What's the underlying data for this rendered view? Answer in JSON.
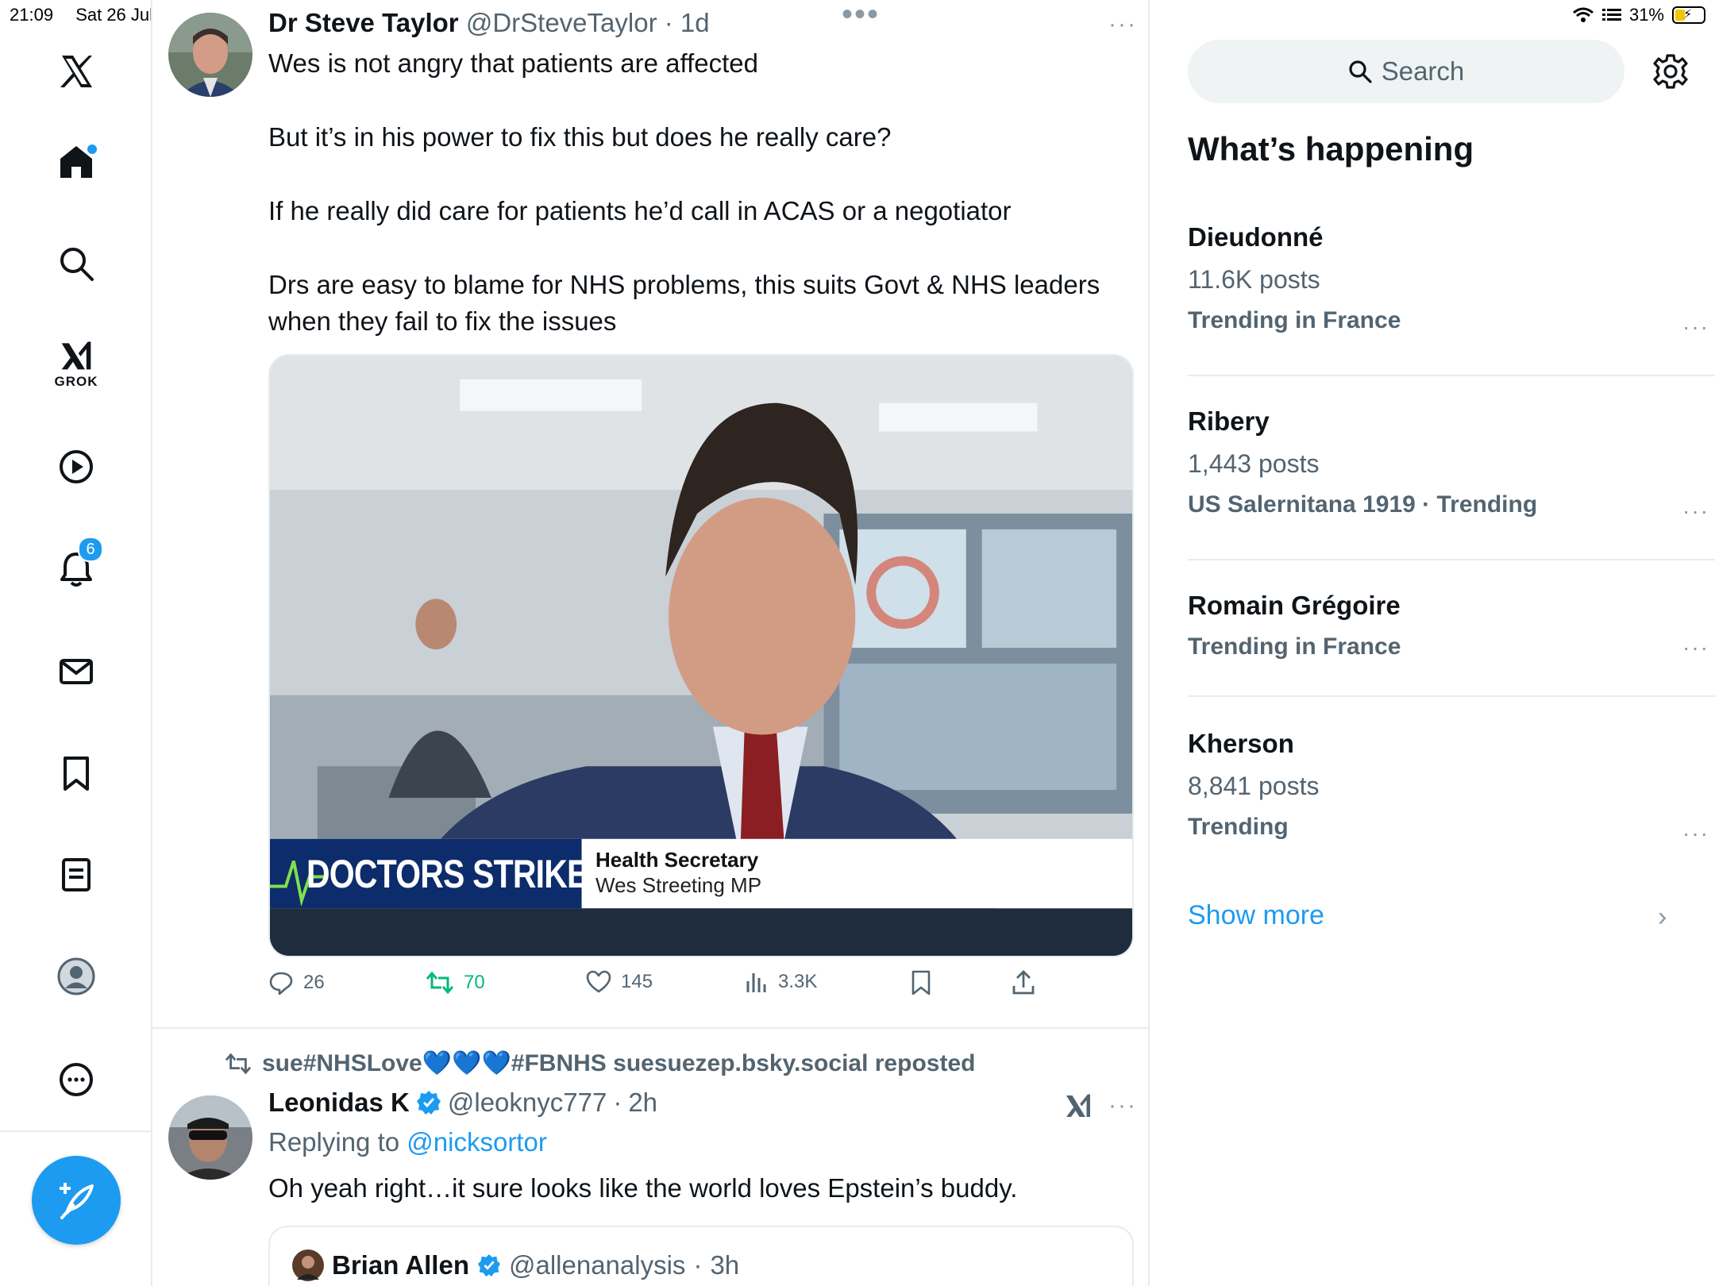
{
  "status_bar": {
    "time": "21:09",
    "date": "Sat 26 Jul",
    "battery": "31%"
  },
  "nav": {
    "grok_label": "GROK",
    "notifications_count": "6"
  },
  "tweet1": {
    "name": "Dr Steve Taylor",
    "handle": "@DrSteveTaylor",
    "time": "1d",
    "paragraphs": [
      "Wes is not angry that patients are affected",
      "But it’s in his power to fix this but does he really care?",
      "If he really did care for patients he’d call in ACAS or a negotiator",
      "Drs are easy to blame for NHS problems, this suits Govt & NHS leaders when they fail to fix the issues"
    ],
    "media": {
      "banner_text": "DOCTORS STRIKE",
      "caption_title": "Health Secretary",
      "caption_name": "Wes Streeting MP"
    },
    "stats": {
      "replies": "26",
      "reposts": "70",
      "likes": "145",
      "views": "3.3K"
    }
  },
  "repost_line": "sue#NHSLove💙💙💙#FBNHS suesuezep.bsky.social reposted",
  "tweet2": {
    "name": "Leonidas K",
    "handle": "@leoknyc777",
    "time": "2h",
    "replying_prefix": "Replying to",
    "replying_to": "@nicksortor",
    "text": "Oh yeah right…it sure looks like the world loves Epstein’s buddy.",
    "quote": {
      "name": "Brian Allen",
      "handle": "@allenanalysis",
      "time": "3h"
    }
  },
  "sidebar": {
    "search_placeholder": "Search",
    "title": "What’s happening",
    "trends": [
      {
        "name": "Dieudonné",
        "posts": "11.6K posts",
        "context": "Trending in France"
      },
      {
        "name": "Ribery",
        "posts": "1,443 posts",
        "context": "US Salernitana 1919 · Trending"
      },
      {
        "name": "Romain Grégoire",
        "posts": "",
        "context": "Trending in France"
      },
      {
        "name": "Kherson",
        "posts": "8,841 posts",
        "context": "Trending"
      }
    ],
    "show_more": "Show more"
  },
  "colors": {
    "accent": "#1d9bf0",
    "repost_green": "#00ba7c",
    "muted": "#536471"
  }
}
